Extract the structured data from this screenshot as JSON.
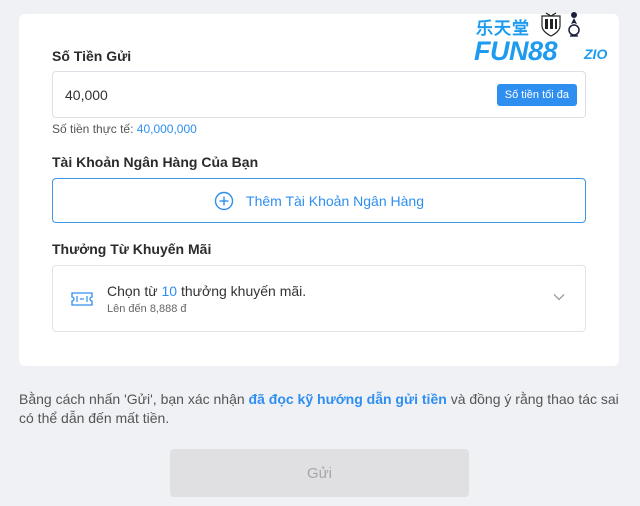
{
  "deposit": {
    "label": "Số Tiền Gửi",
    "amount_value": "40,000",
    "max_button": "Số tiền tối đa",
    "actual_label": "Số tiền thực tế:",
    "actual_value": "40,000,000"
  },
  "bank": {
    "label": "Tài Khoản Ngân Hàng Của Bạn",
    "add_button": "Thêm Tài Khoản Ngân Hàng"
  },
  "promo": {
    "label": "Thưởng Từ Khuyến Mãi",
    "select_prefix": "Chọn từ",
    "select_count": "10",
    "select_suffix": "thưởng khuyến mãi.",
    "select_sub": "Lên đến 8,888 đ"
  },
  "notice": {
    "part1": "Bằng cách nhấn 'Gửi', bạn xác nhận",
    "link": "đã đọc kỹ hướng dẫn gửi tiền",
    "part2": "và đồng ý rằng thao tác sai có thể dẫn đến mất tiền."
  },
  "submit_label": "Gửi",
  "logo": {
    "chinese": "乐天堂",
    "brand": "FUN88",
    "tld": "ZIO"
  },
  "colors": {
    "accent": "#2e8ff0",
    "background": "#f0f1f5",
    "disabled_button": "#e0e0e3"
  },
  "icons": [
    "plus-circle-icon",
    "ticket-icon",
    "chevron-down-icon",
    "newcastle-crest-icon",
    "tottenham-crest-icon"
  ]
}
